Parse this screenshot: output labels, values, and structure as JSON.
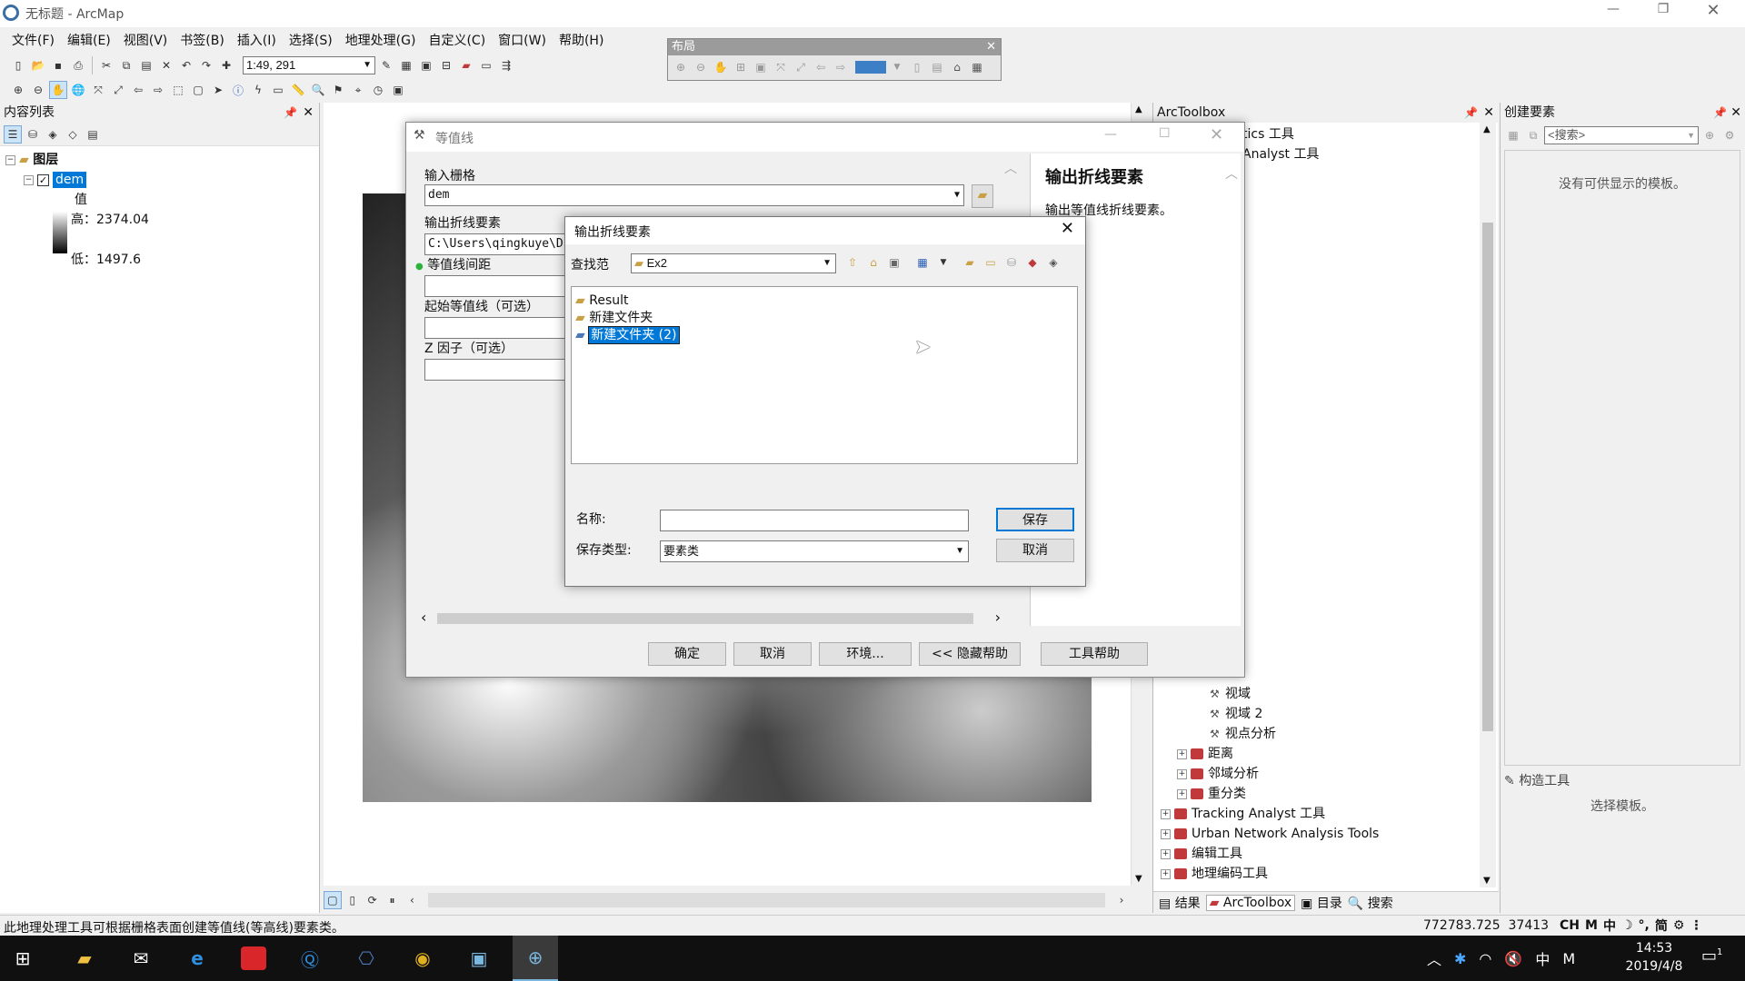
{
  "window": {
    "title": "无标题 - ArcMap"
  },
  "menu": [
    "文件(F)",
    "编辑(E)",
    "视图(V)",
    "书签(B)",
    "插入(I)",
    "选择(S)",
    "地理处理(G)",
    "自定义(C)",
    "窗口(W)",
    "帮助(H)"
  ],
  "toolbar": {
    "scale": "1:49, 291"
  },
  "layout_toolbar": {
    "title": "布局"
  },
  "toc": {
    "title": "内容列表",
    "root": "图层",
    "layer": "dem",
    "legend_title": "值",
    "high": "高：2374.04",
    "low": "低：1497.6"
  },
  "tool_dialog": {
    "title": "等值线",
    "input_raster_label": "输入栅格",
    "input_raster_value": "dem",
    "output_label": "输出折线要素",
    "output_value": "C:\\Users\\qingkuye\\D",
    "interval_label": "等值线间距",
    "base_label": "起始等值线（可选）",
    "z_label": "Z 因子（可选）",
    "help_title": "输出折线要素",
    "help_text": "输出等值线折线要素。",
    "ok": "确定",
    "cancel": "取消",
    "env": "环境...",
    "hide_help": "<< 隐藏帮助",
    "tool_help": "工具帮助"
  },
  "save_dialog": {
    "title": "输出折线要素",
    "lookin_label": "查找范",
    "lookin_value": "Ex2",
    "items": [
      "Result",
      "新建文件夹",
      "新建文件夹 (2)"
    ],
    "name_label": "名称:",
    "name_value": "",
    "type_label": "保存类型:",
    "type_value": "要素类",
    "save": "保存",
    "cancel": "取消"
  },
  "arctoolbox": {
    "title": "ArcToolbox",
    "partial": [
      "tics 工具",
      "Analyst 工具"
    ],
    "tools": [
      "视域",
      "视域 2",
      "视点分析"
    ],
    "toolsets": [
      "距离",
      "邻域分析",
      "重分类"
    ],
    "toolboxes": [
      "Tracking Analyst 工具",
      "Urban Network Analysis Tools",
      "编辑工具",
      "地理编码工具"
    ],
    "tabs": [
      "结果",
      "ArcToolbox",
      "目录",
      "搜索"
    ]
  },
  "create_features": {
    "title": "创建要素",
    "search_placeholder": "<搜索>",
    "empty": "没有可供显示的模板。",
    "construct_title": "构造工具",
    "construct_hint": "选择模板。"
  },
  "status": {
    "message": "此地理处理工具可根据栅格表面创建等值线(等高线)要素类。",
    "coords": "772783.725  37413"
  },
  "taskbar": {
    "time": "14:53",
    "date": "2019/4/8",
    "ime": "中",
    "ime2": "简",
    "notif": "1"
  }
}
